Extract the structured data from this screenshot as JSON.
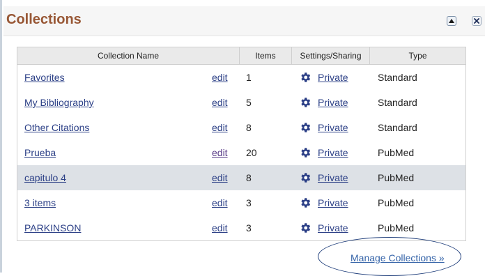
{
  "panel": {
    "title": "Collections"
  },
  "table": {
    "headers": {
      "name": "Collection Name",
      "items": "Items",
      "settings": "Settings/Sharing",
      "type": "Type"
    },
    "rows": [
      {
        "name": "Favorites",
        "edit": "edit",
        "items": "1",
        "sharing": "Private",
        "type": "Standard"
      },
      {
        "name": "My Bibliography",
        "edit": "edit",
        "items": "5",
        "sharing": "Private",
        "type": "Standard"
      },
      {
        "name": "Other Citations",
        "edit": "edit",
        "items": "8",
        "sharing": "Private",
        "type": "Standard"
      },
      {
        "name": "Prueba",
        "edit": "edit",
        "items": "20",
        "sharing": "Private",
        "type": "PubMed"
      },
      {
        "name": "capitulo 4",
        "edit": "edit",
        "items": "8",
        "sharing": "Private",
        "type": "PubMed",
        "highlighted": true
      },
      {
        "name": "3 items",
        "edit": "edit",
        "items": "3",
        "sharing": "Private",
        "type": "PubMed"
      },
      {
        "name": "PARKINSON",
        "edit": "edit",
        "items": "3",
        "sharing": "Private",
        "type": "PubMed"
      }
    ]
  },
  "footer": {
    "manage_link": "Manage Collections »"
  },
  "colors": {
    "title": "#985735",
    "link": "#2b3f86",
    "highlight_row": "#dde1e6",
    "annotation": "#1e3d7a"
  },
  "icons": {
    "collapse": "triangle-up-icon",
    "close": "close-icon",
    "settings": "gear-icon"
  }
}
